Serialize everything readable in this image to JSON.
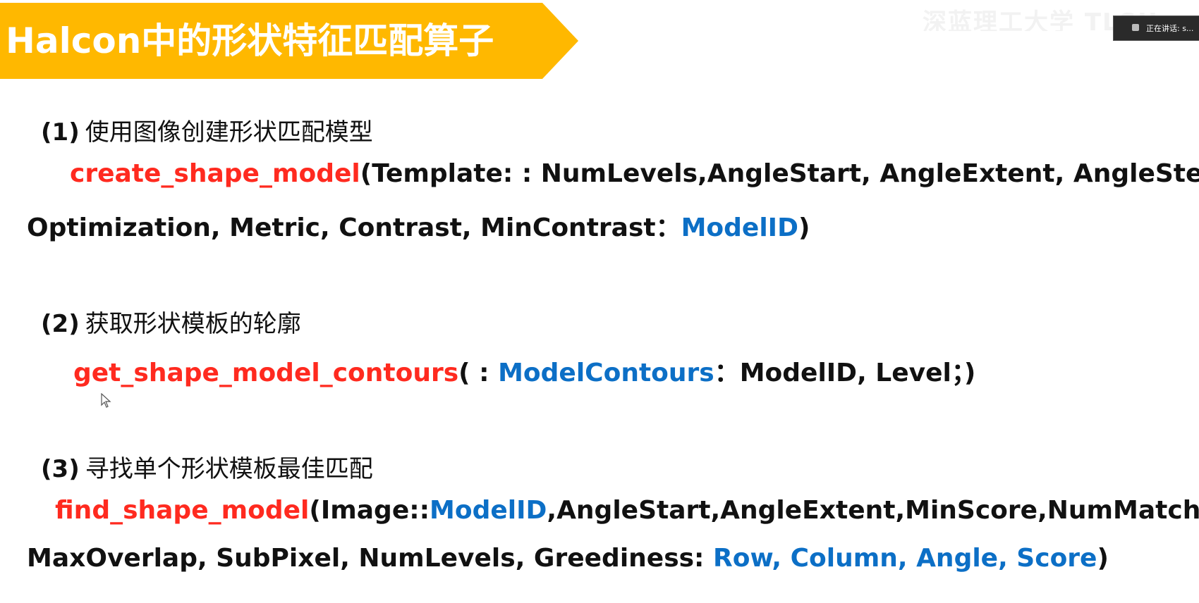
{
  "title": "Halcon中的形状特征匹配算子",
  "overlay": {
    "watermark_text": "深蓝理工大学 TLSU",
    "speaking_label": "正在讲话: s..."
  },
  "sections": [
    {
      "number": "(1)",
      "heading": "使用图像创建形状匹配模型",
      "line1": {
        "function": "create_shape_model",
        "params": "(Template: : NumLevels,AngleStart, AngleExtent, AngleStep,"
      },
      "line2": {
        "params": "Optimization, Metric, Contrast, MinContrast：",
        "output": "ModelID",
        "close": ")"
      }
    },
    {
      "number": "(2)",
      "heading": "获取形状模板的轮廓",
      "line1": {
        "function": "get_shape_model_contours",
        "open": "( : ",
        "output": "ModelContours",
        "params": "：ModelID, Level；)"
      }
    },
    {
      "number": "(3)",
      "heading": "寻找单个形状模板最佳匹配",
      "line1": {
        "function": "find_shape_model",
        "open": "(Image::",
        "input": "ModelID",
        "params": ",AngleStart,AngleExtent,MinScore,NumMatches,"
      },
      "line2": {
        "params": "MaxOverlap, SubPixel, NumLevels, Greediness: ",
        "output": "Row, Column, Angle, Score",
        "close": ")"
      }
    }
  ],
  "colors": {
    "banner": "#ffb800",
    "function": "#ff2a1f",
    "output": "#0c6fc6",
    "text": "#111111"
  }
}
